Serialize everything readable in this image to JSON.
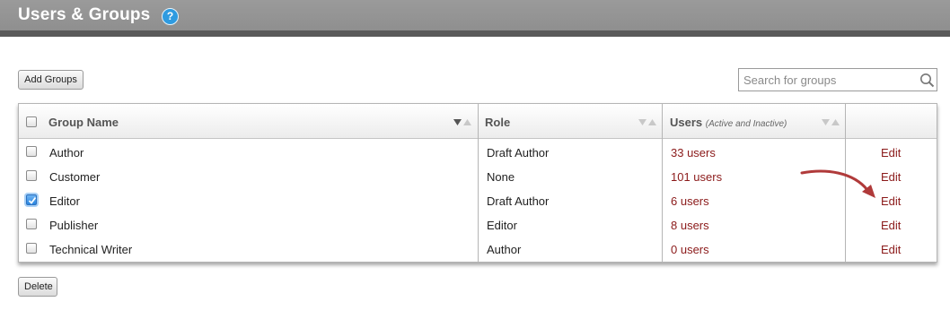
{
  "header": {
    "title": "Users & Groups",
    "help_label": "?"
  },
  "toolbar": {
    "add_groups_label": "Add Groups",
    "delete_label": "Delete"
  },
  "search": {
    "placeholder": "Search for groups",
    "value": ""
  },
  "table": {
    "columns": {
      "group_name": "Group Name",
      "role": "Role",
      "users": "Users",
      "users_sub": "(Active and Inactive)"
    },
    "rows": [
      {
        "name": "Author",
        "role": "Draft Author",
        "users": "33 users",
        "action": "Edit",
        "checked": false
      },
      {
        "name": "Customer",
        "role": "None",
        "users": "101 users",
        "action": "Edit",
        "checked": false
      },
      {
        "name": "Editor",
        "role": "Draft Author",
        "users": "6 users",
        "action": "Edit",
        "checked": true
      },
      {
        "name": "Publisher",
        "role": "Editor",
        "users": "8 users",
        "action": "Edit",
        "checked": false
      },
      {
        "name": "Technical Writer",
        "role": "Author",
        "users": "0 users",
        "action": "Edit",
        "checked": false
      }
    ]
  },
  "colors": {
    "link": "#8b1a1a",
    "header_bg": "#999999",
    "accent": "#2f9be0",
    "annotation": "#b03a3a"
  },
  "icons": {
    "help": "help-icon",
    "search": "search-icon",
    "sort": "sort-arrows-icon"
  }
}
